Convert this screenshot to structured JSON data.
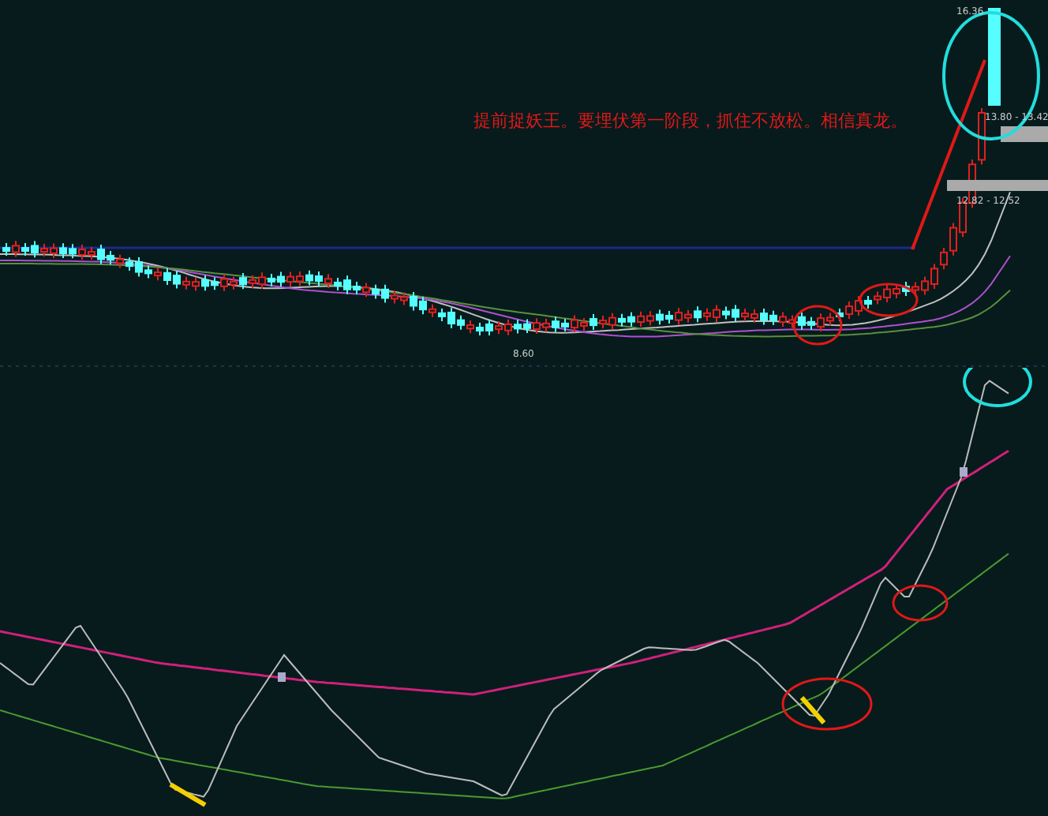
{
  "annotation": "提前捉妖王。要埋伏第一阶段，抓住不放松。相信真龙。",
  "price_labels": [
    "16.36",
    "13.80 - 13.42",
    "12.82 - 12.52",
    "8.60"
  ]
}
